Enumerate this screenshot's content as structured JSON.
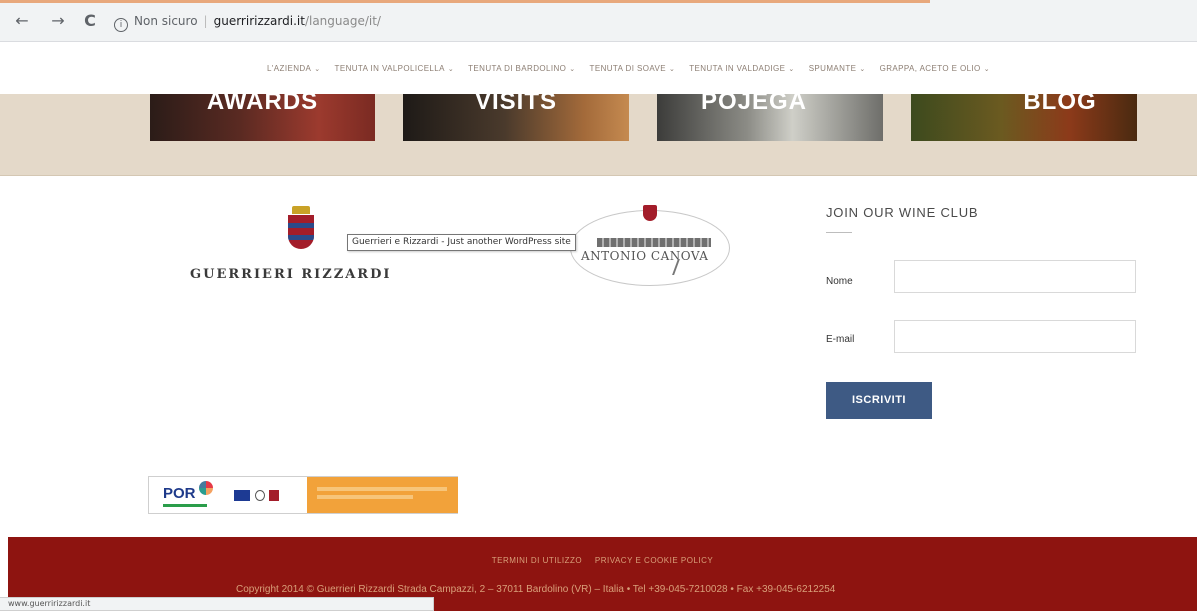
{
  "browser": {
    "back_icon": "←",
    "forward_icon": "→",
    "reload_icon": "C",
    "info_icon": "i",
    "insecure_label": "Non sicuro",
    "separator": "|",
    "url_domain": "guerririzzardi.it",
    "url_path": "/language/it/"
  },
  "nav": {
    "items": [
      {
        "label": "L'AZIENDA"
      },
      {
        "label": "TENUTA IN VALPOLICELLA"
      },
      {
        "label": "TENUTA DI BARDOLINO"
      },
      {
        "label": "TENUTA DI SOAVE"
      },
      {
        "label": "TENUTA IN VALDADIGE"
      },
      {
        "label": "SPUMANTE"
      },
      {
        "label": "GRAPPA, ACETO E OLIO"
      }
    ],
    "caret": "⌄"
  },
  "tiles": {
    "awards": "AWARDS",
    "visits": "VISITS",
    "pojega": "POJEGA",
    "blog": "BLOG"
  },
  "brand": {
    "name": "GUERRIERI RIZZARDI"
  },
  "canova": {
    "name": "ANTONIO CANOVA"
  },
  "tooltip": {
    "text": "Guerrieri e Rizzardi - Just another WordPress site"
  },
  "club": {
    "title": "JOIN OUR WINE CLUB",
    "name_label": "Nome",
    "email_label": "E-mail",
    "submit_label": "ISCRIVITI"
  },
  "por": {
    "text": "POR"
  },
  "footer": {
    "terms": "TERMINI DI UTILIZZO",
    "privacy": "PRIVACY E COOKIE POLICY",
    "copyright": "Copyright 2014 © Guerrieri Rizzardi Strada Campazzi, 2 – 37011 Bardolino (VR) – Italia • Tel +39-045-7210028 • Fax +39-045-6212254"
  },
  "status": {
    "url": "www.guerririzzardi.it"
  },
  "colors": {
    "footer_bg": "#8e1410",
    "button_bg": "#3e5a84",
    "banner_bg": "#e4d9c9"
  }
}
